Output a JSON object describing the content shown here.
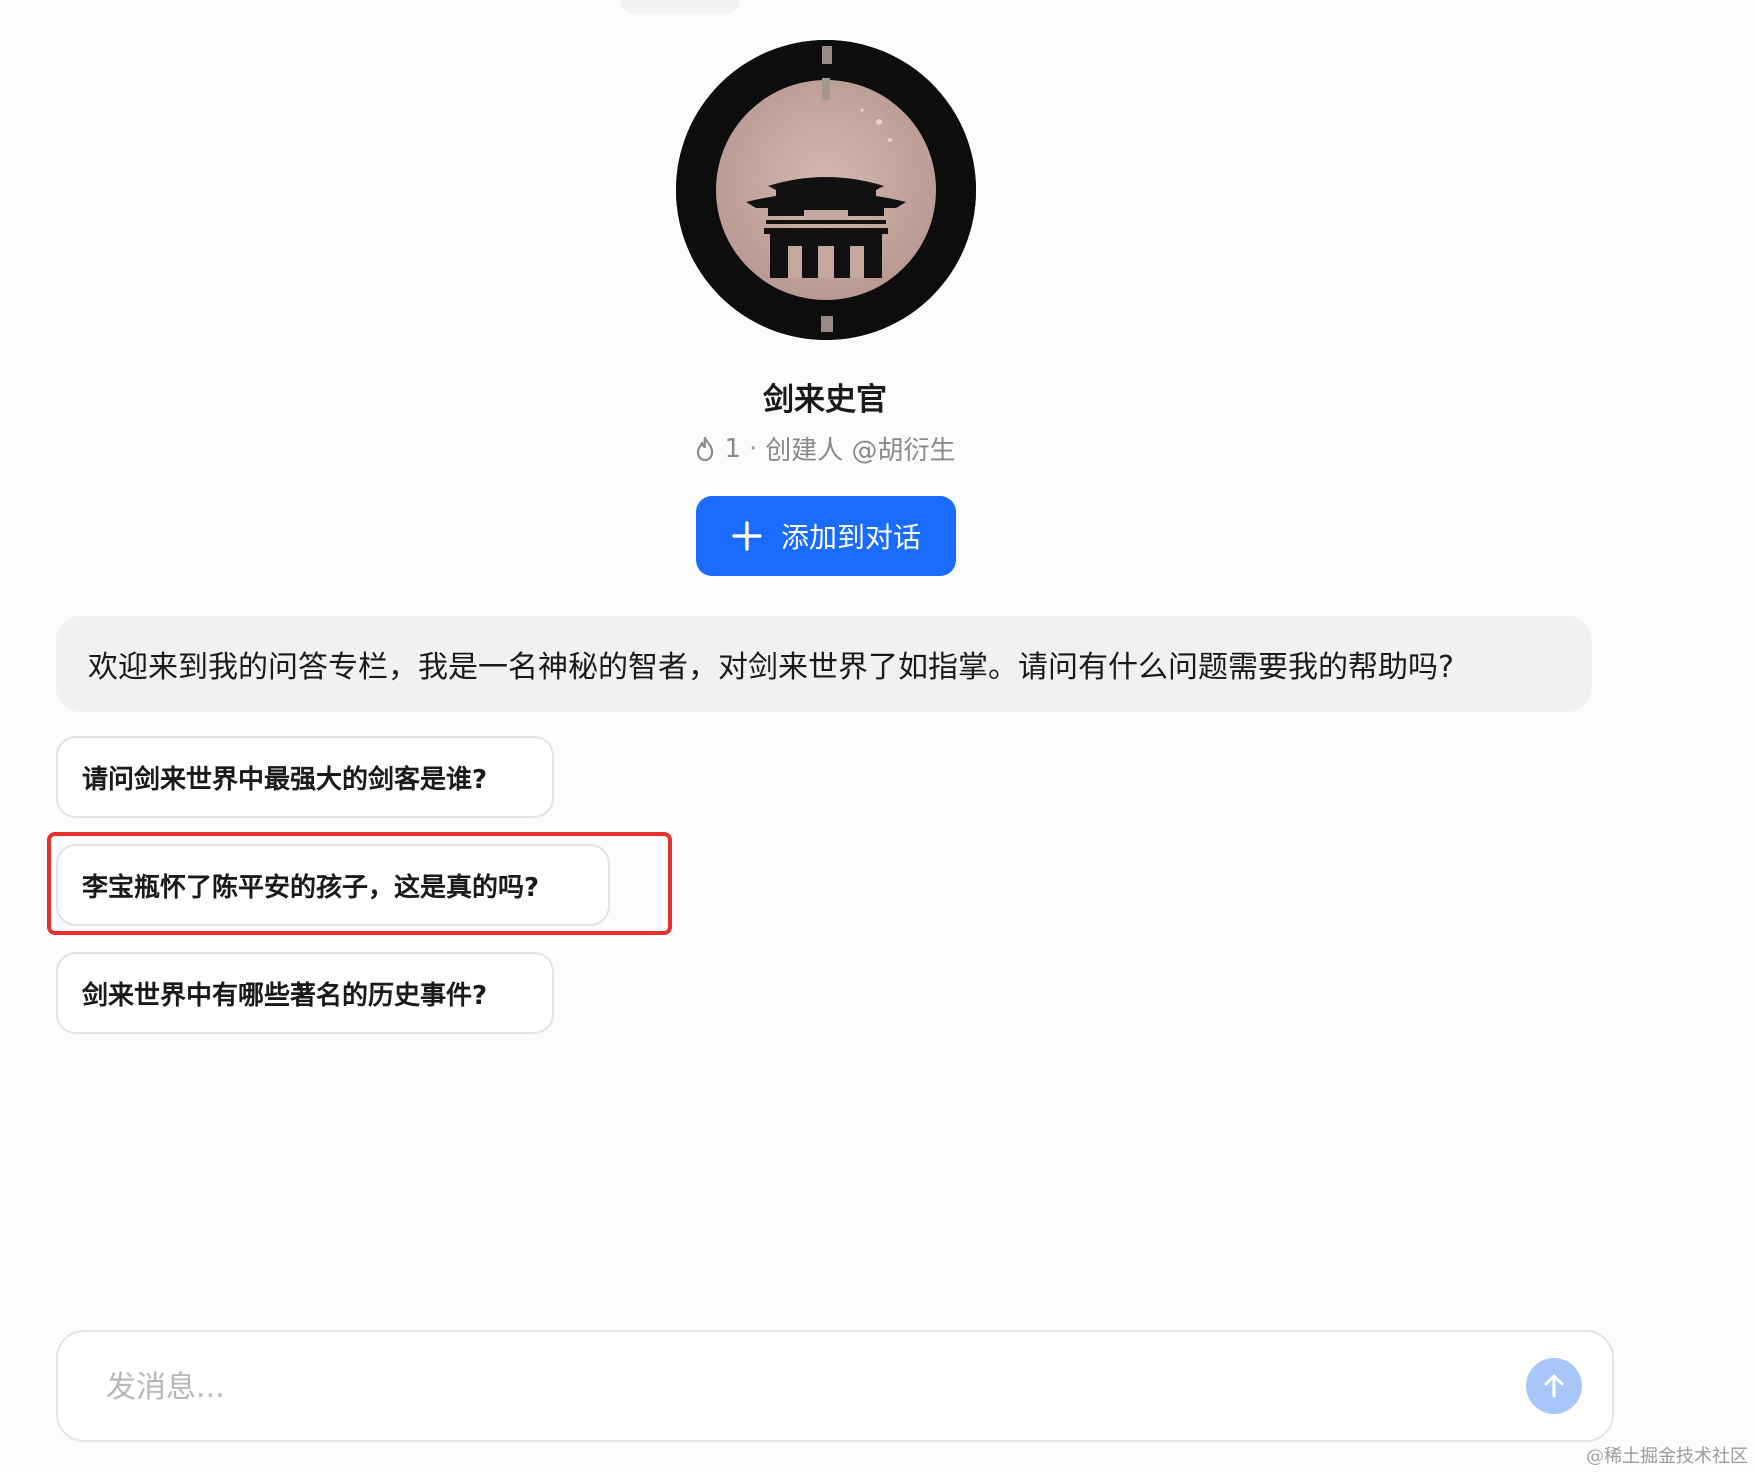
{
  "bot": {
    "name": "剑来史官",
    "avatar_icon": "ancient-gate-avatar",
    "heat_count": "1",
    "meta_separator": "·",
    "creator": "创建人 @胡衍生"
  },
  "actions": {
    "add_label": "添加到对话",
    "add_icon": "plus-icon"
  },
  "welcome_message": "欢迎来到我的问答专栏，我是一名神秘的智者，对剑来世界了如指掌。请问有什么问题需要我的帮助吗?",
  "suggestions": [
    {
      "text": "请问剑来世界中最强大的剑客是谁?"
    },
    {
      "text": "李宝瓶怀了陈平安的孩子，这是真的吗?"
    },
    {
      "text": "剑来世界中有哪些著名的历史事件?"
    }
  ],
  "composer": {
    "placeholder": "发消息...",
    "send_icon": "arrow-up-icon"
  },
  "watermark": "@稀土掘金技术社区",
  "colors": {
    "accent": "#1a6bff",
    "send_disabled": "#a9c6fb",
    "highlight": "#e8302f",
    "welcome_bg": "#f1f1f3"
  }
}
